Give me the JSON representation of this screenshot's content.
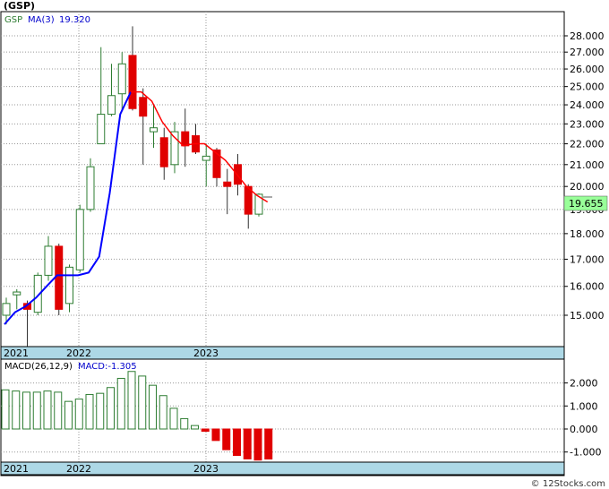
{
  "header": {
    "symbol": "(GSP)"
  },
  "price_panel": {
    "legend": {
      "symbol": "GSP",
      "ma_label": "MA(3)",
      "ma_value": "19.320"
    },
    "last_price": "19.655",
    "y_ticks": [
      "28.000",
      "27.000",
      "26.000",
      "25.000",
      "24.000",
      "23.000",
      "22.000",
      "21.000",
      "20.000",
      "19.000",
      "18.000",
      "17.000",
      "16.000",
      "15.000"
    ],
    "x_ticks": [
      "2021",
      "2022",
      "2023"
    ]
  },
  "macd_panel": {
    "legend": {
      "label": "MACD(26,12,9)",
      "value_label": "MACD:-1.305"
    },
    "y_ticks": [
      "2.000",
      "1.000",
      "0.000",
      "-1.000"
    ],
    "x_ticks": [
      "2021",
      "2022",
      "2023"
    ]
  },
  "footer": {
    "watermark": "© 12Stocks.com"
  },
  "colors": {
    "up": "#2e7d32",
    "down": "#e00000",
    "ma": "#0000ff",
    "ma_down": "#ff0000",
    "axis_band": "#add8e6",
    "last_badge": "#99ff99"
  },
  "chart_data": [
    {
      "type": "candlestick",
      "title": "(GSP)",
      "x_ticks": [
        "2021",
        "2022",
        "2023"
      ],
      "ylim": [
        14,
        28.7
      ],
      "y_scale": "log",
      "grid": true,
      "candles": [
        {
          "o": 15.0,
          "h": 15.6,
          "l": 14.7,
          "c": 15.4
        },
        {
          "o": 15.7,
          "h": 15.9,
          "l": 15.2,
          "c": 15.8
        },
        {
          "o": 15.4,
          "h": 15.5,
          "l": 14.0,
          "c": 15.2
        },
        {
          "o": 15.1,
          "h": 16.5,
          "l": 15.0,
          "c": 16.4
        },
        {
          "o": 16.4,
          "h": 17.9,
          "l": 16.2,
          "c": 17.5
        },
        {
          "o": 17.5,
          "h": 17.6,
          "l": 15.0,
          "c": 15.2
        },
        {
          "o": 15.4,
          "h": 16.8,
          "l": 15.1,
          "c": 16.7
        },
        {
          "o": 16.6,
          "h": 19.2,
          "l": 16.5,
          "c": 19.0
        },
        {
          "o": 19.0,
          "h": 21.3,
          "l": 18.9,
          "c": 20.9
        },
        {
          "o": 22.0,
          "h": 27.3,
          "l": 22.0,
          "c": 23.5
        },
        {
          "o": 23.5,
          "h": 26.3,
          "l": 23.4,
          "c": 24.5
        },
        {
          "o": 24.6,
          "h": 27.0,
          "l": 23.7,
          "c": 26.3
        },
        {
          "o": 26.8,
          "h": 28.6,
          "l": 23.7,
          "c": 23.8
        },
        {
          "o": 24.4,
          "h": 24.9,
          "l": 21.0,
          "c": 23.4
        },
        {
          "o": 22.6,
          "h": 24.0,
          "l": 21.8,
          "c": 22.8
        },
        {
          "o": 22.3,
          "h": 22.8,
          "l": 20.3,
          "c": 20.9
        },
        {
          "o": 21.0,
          "h": 23.1,
          "l": 20.6,
          "c": 22.6
        },
        {
          "o": 22.6,
          "h": 23.8,
          "l": 20.9,
          "c": 21.9
        },
        {
          "o": 22.4,
          "h": 23.0,
          "l": 21.5,
          "c": 21.6
        },
        {
          "o": 21.2,
          "h": 22.0,
          "l": 20.0,
          "c": 21.4
        },
        {
          "o": 21.7,
          "h": 21.8,
          "l": 20.0,
          "c": 20.4
        },
        {
          "o": 20.2,
          "h": 20.8,
          "l": 18.8,
          "c": 20.0
        },
        {
          "o": 21.0,
          "h": 21.5,
          "l": 19.6,
          "c": 20.1
        },
        {
          "o": 20.0,
          "h": 20.1,
          "l": 18.2,
          "c": 18.8
        },
        {
          "o": 18.8,
          "h": 19.7,
          "l": 18.7,
          "c": 19.655
        }
      ],
      "ma3": [
        14.7,
        15.1,
        15.3,
        15.6,
        16.0,
        16.4,
        16.4,
        16.4,
        16.5,
        17.1,
        19.7,
        23.5,
        24.7,
        24.7,
        24.2,
        23.1,
        22.4,
        21.9,
        22.0,
        22.0,
        21.6,
        21.2,
        20.6,
        20.0,
        19.6,
        19.32
      ]
    },
    {
      "type": "bar",
      "title": "MACD(26,12,9)",
      "x_ticks": [
        "2021",
        "2022",
        "2023"
      ],
      "ylim": [
        -1.4,
        2.6
      ],
      "values": [
        1.7,
        1.65,
        1.6,
        1.6,
        1.65,
        1.6,
        1.2,
        1.3,
        1.5,
        1.55,
        1.8,
        2.2,
        2.5,
        2.3,
        1.9,
        1.45,
        0.9,
        0.45,
        0.15,
        -0.1,
        -0.5,
        -0.9,
        -1.15,
        -1.3,
        -1.35,
        -1.305
      ]
    }
  ]
}
